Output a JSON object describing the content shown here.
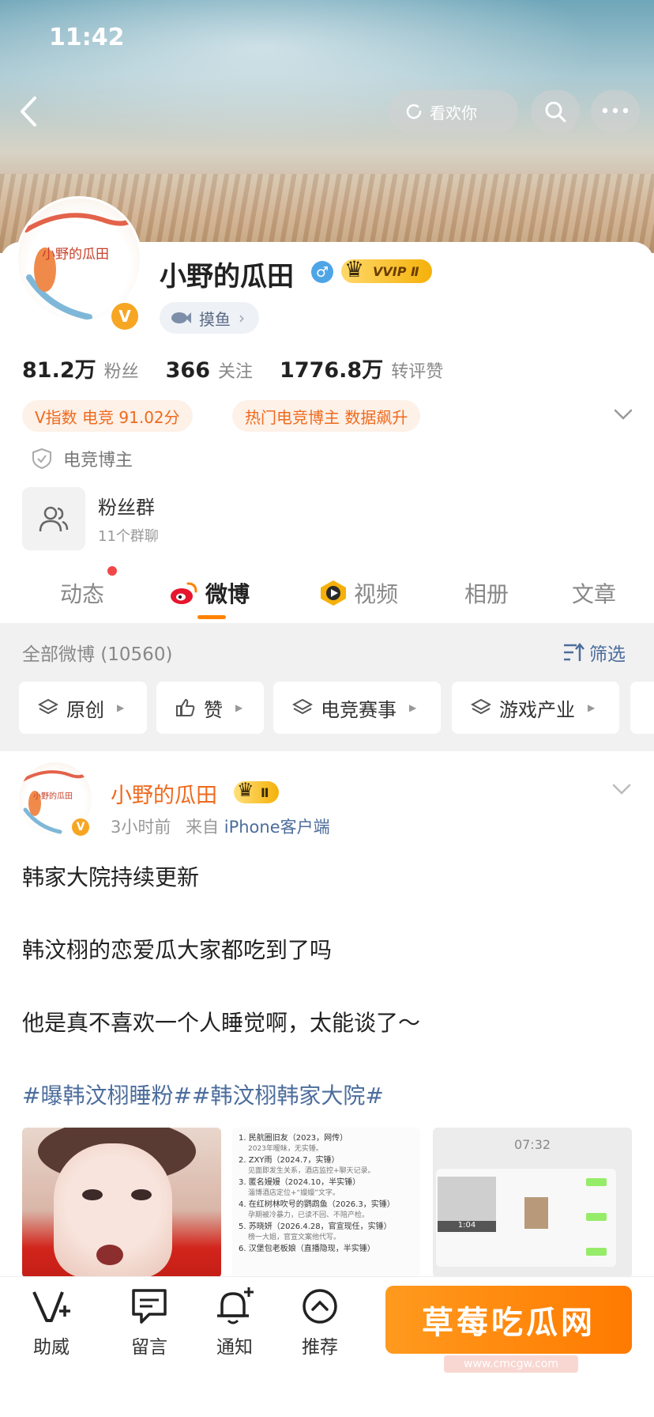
{
  "status": {
    "time": "11:42"
  },
  "header": {
    "follow_label": "看欢你"
  },
  "profile": {
    "name": "小野的瓜田",
    "gender": "♂",
    "vip_label": "VVIP Ⅱ",
    "tag": "摸鱼",
    "stats": [
      {
        "value": "81.2万",
        "label": "粉丝"
      },
      {
        "value": "366",
        "label": "关注"
      },
      {
        "value": "1776.8万",
        "label": "转评赞"
      }
    ],
    "badges": [
      "V指数 电竞 91.02分",
      "热门电竞博主 数据飙升"
    ],
    "verified": "电竞博主",
    "fan_group": {
      "title": "粉丝群",
      "subtitle": "11个群聊"
    },
    "avatar_text": "小野的瓜田"
  },
  "tabs": [
    {
      "label": "动态"
    },
    {
      "label": "微博"
    },
    {
      "label": "视频"
    },
    {
      "label": "相册"
    },
    {
      "label": "文章"
    }
  ],
  "filter": {
    "all_posts": "全部微博 (10560)",
    "filter_label": "筛选",
    "chips": [
      "原创",
      "赞",
      "电竞赛事",
      "游戏产业"
    ]
  },
  "post": {
    "author": "小野的瓜田",
    "badge": "Ⅱ",
    "time": "3小时前",
    "from_prefix": "来自",
    "source": "iPhone客户端",
    "lines": [
      "韩家大院持续更新",
      "韩汶栩的恋爱瓜大家都吃到了吗",
      "他是真不喜欢一个人睡觉啊，太能谈了～"
    ],
    "tags": "#曝韩汶栩睡粉##韩汶栩韩家大院#",
    "image2_lines": [
      {
        "t": "1. 民航圈旧友（2023，网传）",
        "s": "2023年暧昧，无实锤。"
      },
      {
        "t": "2. ZXY雨（2024.7，实锤）",
        "s": "见面即发生关系，酒店监控+聊天记录。"
      },
      {
        "t": "3. 匿名嫚嫚（2024.10，半实锤）",
        "s": "淄博酒店定位+“嫚嫚”文字。"
      },
      {
        "t": "4. 在红树林吹号的鹦鹉鱼（2026.3，实锤）",
        "s": "孕期被冷暴力，已读不回、不陪产检。"
      },
      {
        "t": "5. 苏晓妍（2026.4.28，官宣现任，实锤）",
        "s": "榜一大姐，官宣文案他代写。"
      },
      {
        "t": "6. 汉堡包老板娘（直播隐现，半实锤）",
        "s": ""
      }
    ],
    "image3_time": "07:32",
    "image3_video": "1:04"
  },
  "bottom_bar": {
    "items": [
      {
        "label": "助威",
        "icon": "v-plus-icon"
      },
      {
        "label": "留言",
        "icon": "comment-icon"
      },
      {
        "label": "通知",
        "icon": "bell-plus-icon"
      },
      {
        "label": "推荐",
        "icon": "chevron-up-circle-icon"
      }
    ],
    "promo": "草莓吃瓜网",
    "promo_sub": "www.cmcgw.com"
  },
  "colors": {
    "accent": "#ff8200",
    "link": "#4c6d9c",
    "orange_text": "#ef6a1e",
    "badge_bg": "#fdf1e8"
  }
}
